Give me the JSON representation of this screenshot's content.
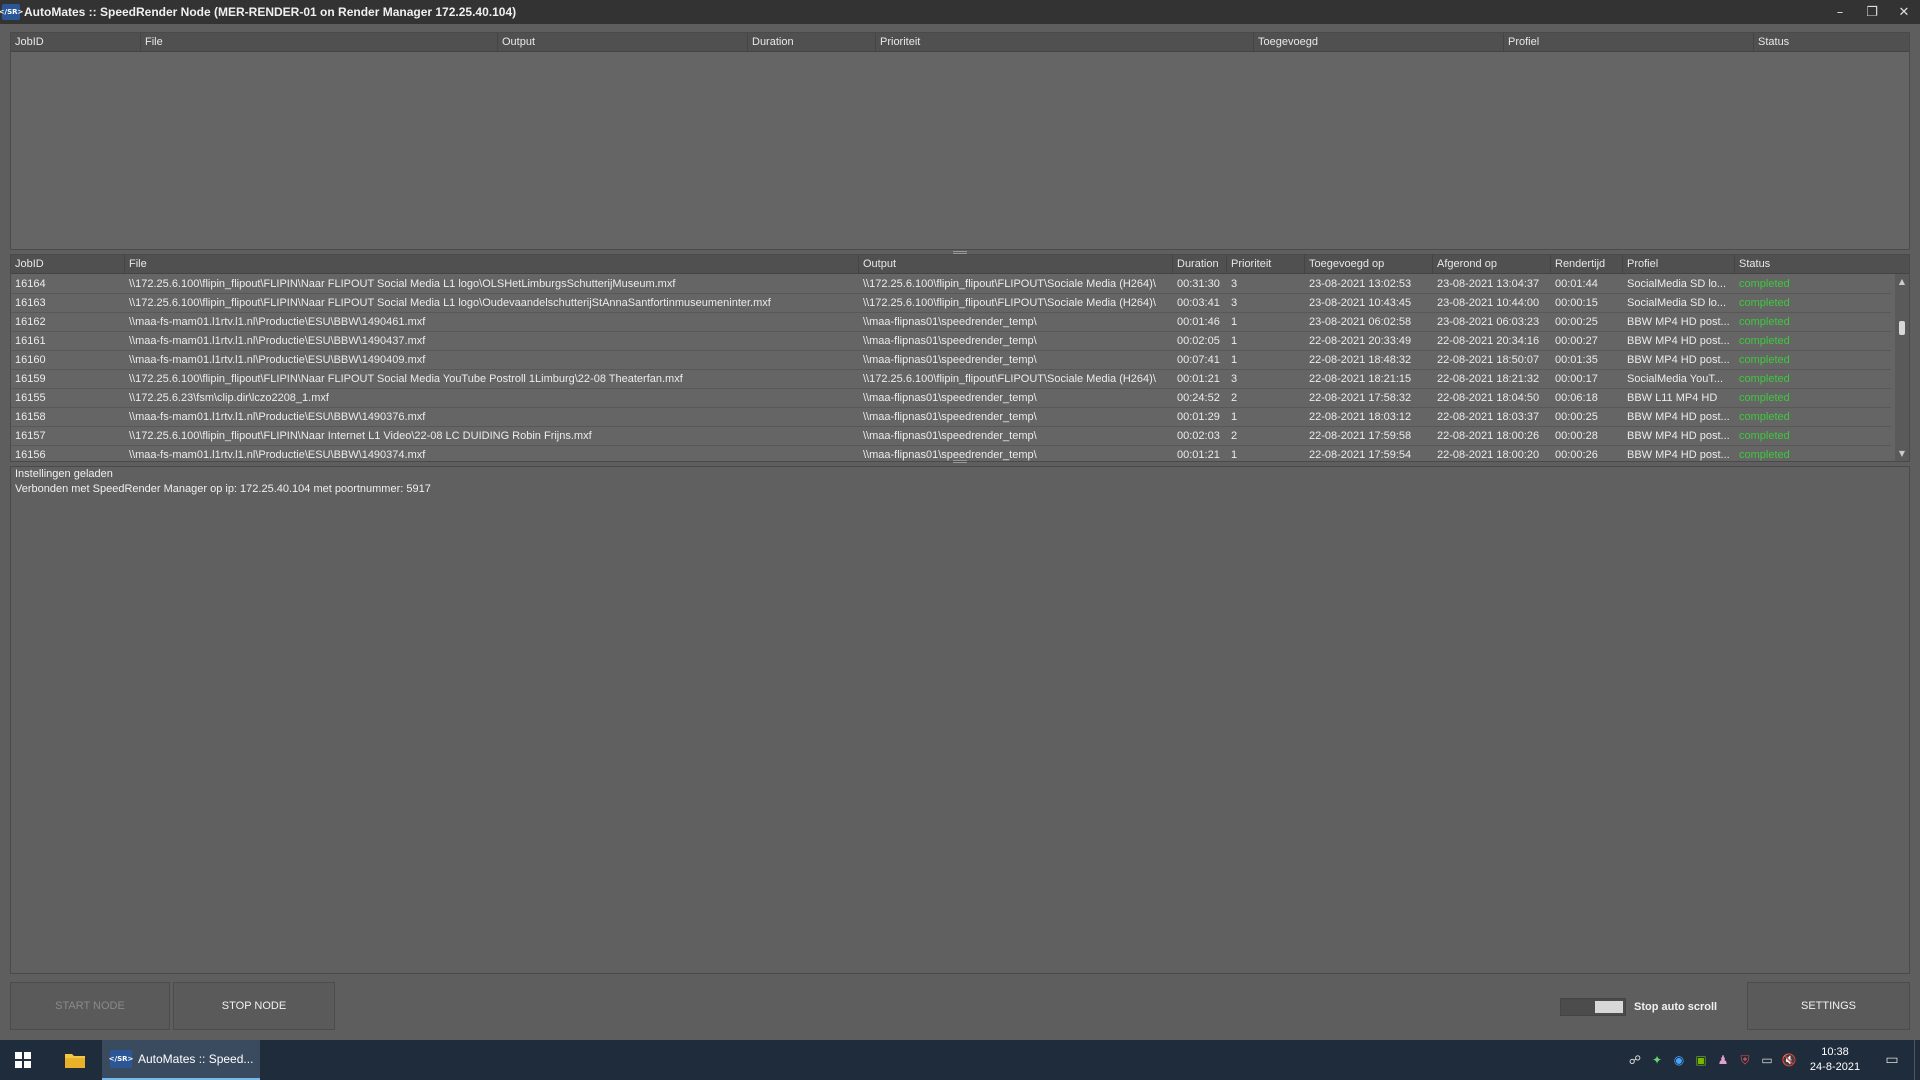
{
  "window": {
    "title": "AutoMates :: SpeedRender Node (MER-RENDER-01 on Render Manager 172.25.40.104)",
    "icon_text": "</SR>",
    "minimize_glyph": "–",
    "restore_glyph": "❐",
    "close_glyph": "✕"
  },
  "queue_grid": {
    "columns": [
      "JobID",
      "File",
      "Output",
      "Duration",
      "Prioriteit",
      "Toegevoegd",
      "Profiel",
      "Status"
    ],
    "rows": []
  },
  "history_grid": {
    "columns": [
      "JobID",
      "File",
      "Output",
      "Duration",
      "Prioriteit",
      "Toegevoegd op",
      "Afgerond op",
      "Rendertijd",
      "Profiel",
      "Status"
    ],
    "rows": [
      [
        "16164",
        "\\\\172.25.6.100\\flipin_flipout\\FLIPIN\\Naar FLIPOUT Social Media L1 logo\\OLSHetLimburgsSchutterijMuseum.mxf",
        "\\\\172.25.6.100\\flipin_flipout\\FLIPOUT\\Sociale Media (H264)\\",
        "00:31:30",
        "3",
        "23-08-2021 13:02:53",
        "23-08-2021 13:04:37",
        "00:01:44",
        "SocialMedia SD lo...",
        "completed"
      ],
      [
        "16163",
        "\\\\172.25.6.100\\flipin_flipout\\FLIPIN\\Naar FLIPOUT Social Media L1 logo\\OudevaandelschutterijStAnnaSantfortinmuseumeninter.mxf",
        "\\\\172.25.6.100\\flipin_flipout\\FLIPOUT\\Sociale Media (H264)\\",
        "00:03:41",
        "3",
        "23-08-2021 10:43:45",
        "23-08-2021 10:44:00",
        "00:00:15",
        "SocialMedia SD lo...",
        "completed"
      ],
      [
        "16162",
        "\\\\maa-fs-mam01.l1rtv.l1.nl\\Productie\\ESU\\BBW\\1490461.mxf",
        "\\\\maa-flipnas01\\speedrender_temp\\",
        "00:01:46",
        "1",
        "23-08-2021 06:02:58",
        "23-08-2021 06:03:23",
        "00:00:25",
        "BBW MP4 HD post...",
        "completed"
      ],
      [
        "16161",
        "\\\\maa-fs-mam01.l1rtv.l1.nl\\Productie\\ESU\\BBW\\1490437.mxf",
        "\\\\maa-flipnas01\\speedrender_temp\\",
        "00:02:05",
        "1",
        "22-08-2021 20:33:49",
        "22-08-2021 20:34:16",
        "00:00:27",
        "BBW MP4 HD post...",
        "completed"
      ],
      [
        "16160",
        "\\\\maa-fs-mam01.l1rtv.l1.nl\\Productie\\ESU\\BBW\\1490409.mxf",
        "\\\\maa-flipnas01\\speedrender_temp\\",
        "00:07:41",
        "1",
        "22-08-2021 18:48:32",
        "22-08-2021 18:50:07",
        "00:01:35",
        "BBW MP4 HD post...",
        "completed"
      ],
      [
        "16159",
        "\\\\172.25.6.100\\flipin_flipout\\FLIPIN\\Naar FLIPOUT Social Media YouTube Postroll 1Limburg\\22-08 Theaterfan.mxf",
        "\\\\172.25.6.100\\flipin_flipout\\FLIPOUT\\Sociale Media (H264)\\",
        "00:01:21",
        "3",
        "22-08-2021 18:21:15",
        "22-08-2021 18:21:32",
        "00:00:17",
        "SocialMedia YouT...",
        "completed"
      ],
      [
        "16155",
        "\\\\172.25.6.23\\fsm\\clip.dir\\lczo2208_1.mxf",
        "\\\\maa-flipnas01\\speedrender_temp\\",
        "00:24:52",
        "2",
        "22-08-2021 17:58:32",
        "22-08-2021 18:04:50",
        "00:06:18",
        "BBW L11 MP4 HD",
        "completed"
      ],
      [
        "16158",
        "\\\\maa-fs-mam01.l1rtv.l1.nl\\Productie\\ESU\\BBW\\1490376.mxf",
        "\\\\maa-flipnas01\\speedrender_temp\\",
        "00:01:29",
        "1",
        "22-08-2021 18:03:12",
        "22-08-2021 18:03:37",
        "00:00:25",
        "BBW MP4 HD post...",
        "completed"
      ],
      [
        "16157",
        "\\\\172.25.6.100\\flipin_flipout\\FLIPIN\\Naar Internet L1 Video\\22-08 LC DUIDING Robin Frijns.mxf",
        "\\\\maa-flipnas01\\speedrender_temp\\",
        "00:02:03",
        "2",
        "22-08-2021 17:59:58",
        "22-08-2021 18:00:26",
        "00:00:28",
        "BBW MP4 HD post...",
        "completed"
      ],
      [
        "16156",
        "\\\\maa-fs-mam01.l1rtv.l1.nl\\Productie\\ESU\\BBW\\1490374.mxf",
        "\\\\maa-flipnas01\\speedrender_temp\\",
        "00:01:21",
        "1",
        "22-08-2021 17:59:54",
        "22-08-2021 18:00:20",
        "00:00:26",
        "BBW MP4 HD post...",
        "completed"
      ]
    ]
  },
  "log": {
    "lines": [
      "Instellingen geladen",
      "Verbonden met SpeedRender Manager op ip: 172.25.40.104 met poortnummer: 5917"
    ]
  },
  "controls": {
    "start_label": "START NODE",
    "stop_label": "STOP NODE",
    "auto_scroll_label": "Stop auto scroll",
    "settings_label": "SETTINGS"
  },
  "taskbar": {
    "app_label": "AutoMates :: Speed...",
    "app_icon_text": "</SR>",
    "time": "10:38",
    "date": "24-8-2021"
  },
  "colors": {
    "status_completed": "#3ec93e",
    "accent": "#76b9ed"
  }
}
